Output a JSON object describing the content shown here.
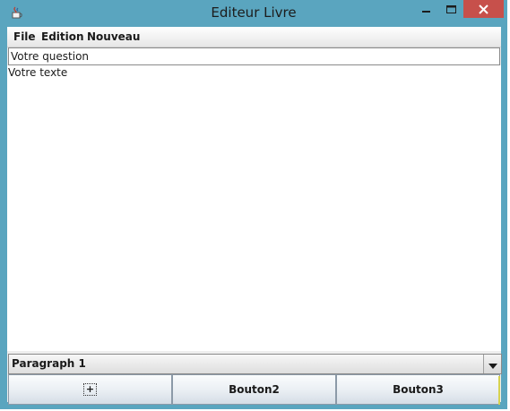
{
  "window": {
    "title": "Editeur Livre"
  },
  "menubar": {
    "items": [
      "File",
      "Edition",
      "Nouveau"
    ]
  },
  "question_field": {
    "value": "Votre question"
  },
  "text_area": {
    "value": "Votre texte"
  },
  "paragraph_select": {
    "selected": "Paragraph 1"
  },
  "buttons": {
    "button1": "+",
    "button2": "Bouton2",
    "button3": "Bouton3"
  },
  "colors": {
    "titlebar": "#5aa5bf",
    "close_button": "#c7504b"
  },
  "icons": {
    "app": "java-cup-icon",
    "minimize": "minimize-icon",
    "maximize": "maximize-icon",
    "close": "close-icon",
    "dropdown": "chevron-down-icon"
  }
}
